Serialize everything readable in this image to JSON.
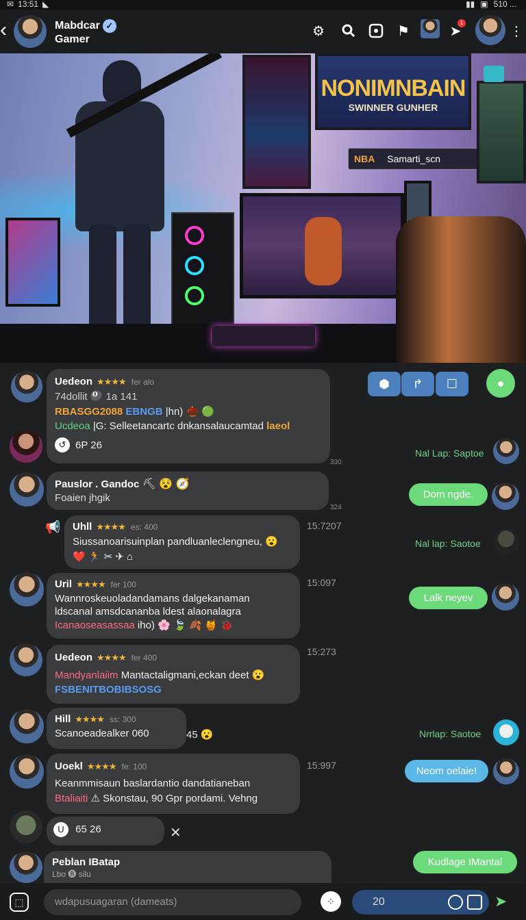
{
  "status": {
    "time": "13:51",
    "right": "510 ..."
  },
  "header": {
    "title_line1": "Mabdcar",
    "title_line2": "Gamer",
    "badge_count": "1"
  },
  "hero": {
    "poster_title": "NONIMNBAIN",
    "poster_subtitle": "SWINNER GUNHER",
    "tag_prefix": "NBA",
    "tag_text": "Samarti_scn"
  },
  "messages": [
    {
      "name": "Uedeon",
      "stars": "★★★★",
      "meta": "fer alo",
      "line1": "74dollit 🎱 1a 141",
      "line2a": "RBASGG2088",
      "line2b": "EBNGB",
      "line2c": " |hn) 🌰 🟢",
      "line3a": "Ucdeoa",
      "line3b": " |G: ",
      "line3c": "Selleetancartc dnkansalaucamtad ",
      "line3d": "laeol",
      "reacts": "6P  26",
      "time": "330"
    },
    {
      "name": "Pauslor . Gandoc",
      "meta": "",
      "line1": "Foaien jhgik",
      "time": "324"
    },
    {
      "name": "Uhll",
      "stars": "★★★★",
      "meta": "es: 400",
      "line1": "Siussanoarisuinplan pandluanleclengneu, 😮",
      "line2": "❤️ 🏃 ✂ ✈ ⌂",
      "time": "15:7207"
    },
    {
      "name": "Uril",
      "stars": "★★★★",
      "meta": "fer 100",
      "line1": "Wannroskeuoladandamans dalgekanaman",
      "line2": "ldscanal amsdcananba ldest alaonalagra",
      "line3a": "Icanaoseasassaa",
      "line3b": " iho) 🌸 🍃 🍂 🍯 🐞",
      "time": "15:097"
    },
    {
      "name": "Uedeon",
      "stars": "★★★★",
      "meta": "fer 400",
      "line1a": "Mandyanlaiim",
      "line1b": " Mantactaligmani,eckan deet 😮",
      "line2": "FSBENITBOBIBSOSG",
      "time": "15:273"
    },
    {
      "name": "Hill",
      "stars": "★★★★",
      "meta": "ss: 300",
      "line1": "Scanoeadealker 060",
      "after": "45 😮",
      "time": ""
    },
    {
      "name": "Uoekl",
      "stars": "★★★★",
      "meta": "fe: 100",
      "line1": "Keanmmisaun baslardantio dandatianeban",
      "line2a": "Btaliaiti",
      "line2b": " ⚠ Skonstau, 90 Gpr pordami. Vehng",
      "time": "15:997"
    },
    {
      "reacts": "65  26"
    },
    {
      "name": "Peblan IBatap",
      "line1": "Lbo 🅑 silu"
    }
  ],
  "right_side": {
    "label1": "Nal Lap: Saptoe",
    "pill1": "Dom ngde.",
    "label2": "Nal lap: Saotoe",
    "pill2": "Lalk neyev",
    "label3": "Nrrlap: Saotoe",
    "pill3": "Neom oelaie!",
    "pill4": "Kudlage IMantal"
  },
  "input": {
    "placeholder": "wdapusuagaran (dameats)",
    "count": "20"
  },
  "colors": {
    "accent_green": "#6cd97a",
    "accent_blue": "#5ab7e8",
    "bubble": "#3a3b3d",
    "background": "#1e1f21"
  }
}
